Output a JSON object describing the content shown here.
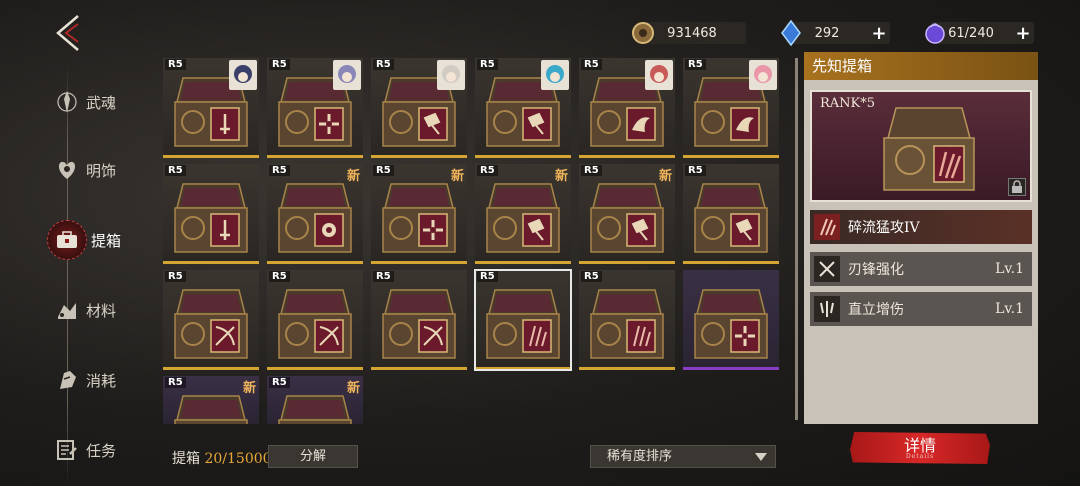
{
  "resources": {
    "gold": {
      "value": "931468",
      "icon": "coin-icon"
    },
    "crystal": {
      "value": "292",
      "plus": "+",
      "icon": "blue-crystal-icon"
    },
    "stamina": {
      "value": "61/240",
      "plus": "+",
      "icon": "purple-orb-icon"
    }
  },
  "sidebar": {
    "items": [
      {
        "label": "武魂",
        "icon": "spirit-statue-icon",
        "active": false
      },
      {
        "label": "明饰",
        "icon": "heart-emblem-icon",
        "active": false
      },
      {
        "label": "提箱",
        "icon": "case-icon",
        "active": true
      },
      {
        "label": "材料",
        "icon": "materials-icon",
        "active": false
      },
      {
        "label": "消耗",
        "icon": "consumable-icon",
        "active": false
      },
      {
        "label": "任务",
        "icon": "task-icon",
        "active": false
      }
    ]
  },
  "grid": {
    "items": [
      {
        "rank": "R5",
        "new": "",
        "emblem": "sword",
        "portrait": "#3a3f6a",
        "rarity": "gold"
      },
      {
        "rank": "R5",
        "new": "",
        "emblem": "cross",
        "portrait": "#8a86b8",
        "rarity": "gold"
      },
      {
        "rank": "R5",
        "new": "",
        "emblem": "hammer",
        "portrait": "#d0ccc4",
        "rarity": "gold"
      },
      {
        "rank": "R5",
        "new": "",
        "emblem": "hammer",
        "portrait": "#3aa8c8",
        "rarity": "gold"
      },
      {
        "rank": "R5",
        "new": "",
        "emblem": "bird",
        "portrait": "#c85a5a",
        "rarity": "gold"
      },
      {
        "rank": "R5",
        "new": "",
        "emblem": "bird",
        "portrait": "#e896a8",
        "rarity": "gold"
      },
      {
        "rank": "R5",
        "new": "",
        "emblem": "sword",
        "portrait": "",
        "rarity": "gold"
      },
      {
        "rank": "R5",
        "new": "新",
        "emblem": "fist",
        "portrait": "",
        "rarity": "gold"
      },
      {
        "rank": "R5",
        "new": "新",
        "emblem": "cross",
        "portrait": "",
        "rarity": "gold"
      },
      {
        "rank": "R5",
        "new": "新",
        "emblem": "hammer",
        "portrait": "",
        "rarity": "gold"
      },
      {
        "rank": "R5",
        "new": "新",
        "emblem": "hammer",
        "portrait": "",
        "rarity": "gold"
      },
      {
        "rank": "R5",
        "new": "",
        "emblem": "hammer",
        "portrait": "",
        "rarity": "gold"
      },
      {
        "rank": "R5",
        "new": "",
        "emblem": "bow",
        "portrait": "",
        "rarity": "gold"
      },
      {
        "rank": "R5",
        "new": "",
        "emblem": "bow",
        "portrait": "",
        "rarity": "gold"
      },
      {
        "rank": "R5",
        "new": "",
        "emblem": "bow",
        "portrait": "",
        "rarity": "gold"
      },
      {
        "rank": "R5",
        "new": "",
        "emblem": "claw",
        "portrait": "",
        "rarity": "gold",
        "selected": true
      },
      {
        "rank": "R5",
        "new": "",
        "emblem": "claw",
        "portrait": "",
        "rarity": "gold"
      },
      {
        "rank": "",
        "new": "",
        "emblem": "cross",
        "portrait": "",
        "rarity": "purple"
      },
      {
        "rank": "R5",
        "new": "新",
        "emblem": "",
        "portrait": "",
        "rarity": "purple"
      },
      {
        "rank": "R5",
        "new": "新",
        "emblem": "",
        "portrait": "",
        "rarity": "purple"
      }
    ]
  },
  "bottom": {
    "count_label": "提箱 ",
    "count_current": "20",
    "count_sep": "/",
    "count_max": "15000",
    "decompose_label": "分解",
    "sort_label": "稀有度排序"
  },
  "panel": {
    "title": "先知提箱",
    "rank_text": "RANK*5",
    "main_skill": "碎流猛攻IV",
    "sub_skills": [
      {
        "name": "刃锋强化",
        "level": "Lv.1",
        "icon": "blades-icon"
      },
      {
        "name": "直立增伤",
        "level": "Lv.1",
        "icon": "trident-icon"
      }
    ],
    "detail_label": "详情",
    "detail_sub": "Details"
  },
  "colors": {
    "accent_gold": "#d4a532",
    "accent_red": "#c82020",
    "rarity_purple": "#8a3cc4",
    "panel_title": "#a8721e"
  }
}
